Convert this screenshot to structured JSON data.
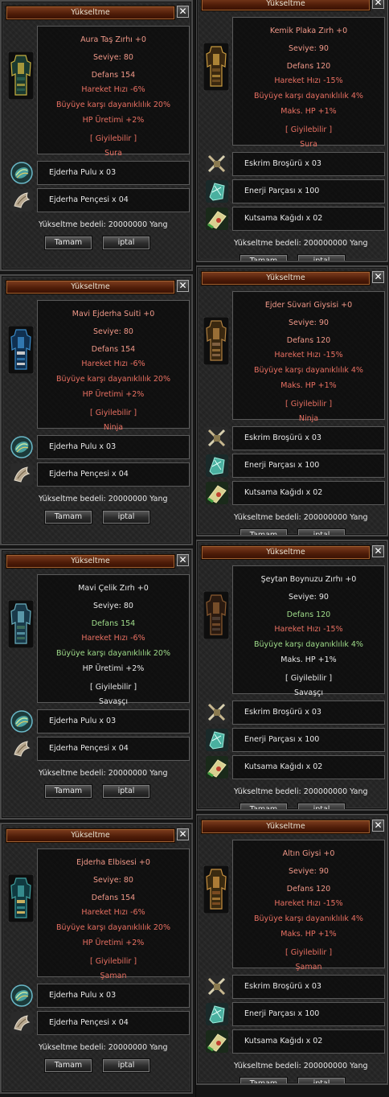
{
  "dialogs": [
    {
      "title": "Yükseltme",
      "item_icon": "armor-aura-tas-icon",
      "item_colors": [
        "#1a3a30",
        "#c8b040",
        "#2a5a4a"
      ],
      "lines": [
        {
          "text": "Aura Taş Zırhı +0",
          "color": "salmon"
        },
        {
          "text": "Seviye: 80",
          "color": "salmon"
        },
        {
          "text": "Defans 154",
          "color": "salmon"
        },
        {
          "text": "Hareket Hızı -6%",
          "color": "red"
        },
        {
          "text": "Büyüye karşı dayanıklılık 20%",
          "color": "red"
        },
        {
          "text": "HP Üretimi +2%",
          "color": "red"
        },
        {
          "text": "[ Giyilebilir ]",
          "color": "red"
        },
        {
          "text": "Sura",
          "color": "red"
        }
      ],
      "materials": [
        {
          "text": "Ejderha Pulu x 03",
          "icon": "dragon-scale-icon"
        },
        {
          "text": "Ejderha Pençesi x 04",
          "icon": "dragon-claw-icon"
        }
      ],
      "cost": "Yükseltme bedeli: 20000000 Yang",
      "ok": "Tamam",
      "cancel": "iptal"
    },
    {
      "title": "Yükseltme",
      "item_icon": "armor-kemik-plaka-icon",
      "item_colors": [
        "#3a2810",
        "#c89a40",
        "#6a4a20"
      ],
      "lines": [
        {
          "text": "Kemik Plaka Zırh +0",
          "color": "salmon"
        },
        {
          "text": "Seviye: 90",
          "color": "salmon"
        },
        {
          "text": "Defans 120",
          "color": "salmon"
        },
        {
          "text": "Hareket Hızı -15%",
          "color": "red"
        },
        {
          "text": "Büyüye karşı dayanıklılık 4%",
          "color": "red"
        },
        {
          "text": "Maks. HP +1%",
          "color": "red"
        },
        {
          "text": "[ Giyilebilir ]",
          "color": "red"
        },
        {
          "text": "Sura",
          "color": "red"
        }
      ],
      "materials": [
        {
          "text": "Eskrim Broşürü x 03",
          "icon": "fencing-brochure-icon"
        },
        {
          "text": "Enerji Parçası x 100",
          "icon": "energy-fragment-icon"
        },
        {
          "text": "Kutsama Kağıdı x 02",
          "icon": "blessing-scroll-icon"
        }
      ],
      "cost": "Yükseltme bedeli: 200000000 Yang",
      "ok": "Tamam",
      "cancel": "iptal"
    },
    {
      "title": "Yükseltme",
      "item_icon": "armor-mavi-ejderha-icon",
      "item_colors": [
        "#103050",
        "#3a8ac8",
        "#c8c8c8"
      ],
      "lines": [
        {
          "text": "Mavi Ejderha Suiti +0",
          "color": "salmon"
        },
        {
          "text": "Seviye: 80",
          "color": "salmon"
        },
        {
          "text": "Defans 154",
          "color": "salmon"
        },
        {
          "text": "Hareket Hızı -6%",
          "color": "red"
        },
        {
          "text": "Büyüye karşı dayanıklılık 20%",
          "color": "red"
        },
        {
          "text": "HP Üretimi +2%",
          "color": "red"
        },
        {
          "text": "[ Giyilebilir ]",
          "color": "red"
        },
        {
          "text": "Ninja",
          "color": "red"
        }
      ],
      "materials": [
        {
          "text": "Ejderha Pulu x 03",
          "icon": "dragon-scale-icon"
        },
        {
          "text": "Ejderha Pençesi x 04",
          "icon": "dragon-claw-icon"
        }
      ],
      "cost": "Yükseltme bedeli: 20000000 Yang",
      "ok": "Tamam",
      "cancel": "iptal"
    },
    {
      "title": "Yükseltme",
      "item_icon": "armor-ejder-suvari-icon",
      "item_colors": [
        "#3a2810",
        "#b08040",
        "#806040"
      ],
      "lines": [
        {
          "text": "Ejder Süvari Giysisi +0",
          "color": "salmon"
        },
        {
          "text": "Seviye: 90",
          "color": "salmon"
        },
        {
          "text": "Defans 120",
          "color": "salmon"
        },
        {
          "text": "Hareket Hızı -15%",
          "color": "red"
        },
        {
          "text": "Büyüye karşı dayanıklılık 4%",
          "color": "red"
        },
        {
          "text": "Maks. HP +1%",
          "color": "red"
        },
        {
          "text": "[ Giyilebilir ]",
          "color": "red"
        },
        {
          "text": "Ninja",
          "color": "red"
        }
      ],
      "materials": [
        {
          "text": "Eskrim Broşürü x 03",
          "icon": "fencing-brochure-icon"
        },
        {
          "text": "Enerji Parçası x 100",
          "icon": "energy-fragment-icon"
        },
        {
          "text": "Kutsama Kağıdı x 02",
          "icon": "blessing-scroll-icon"
        }
      ],
      "cost": "Yükseltme bedeli: 200000000 Yang",
      "ok": "Tamam",
      "cancel": "iptal"
    },
    {
      "title": "Yükseltme",
      "item_icon": "armor-mavi-celik-icon",
      "item_colors": [
        "#1a3a4a",
        "#6ab0c0",
        "#3a6a5a"
      ],
      "lines": [
        {
          "text": "Mavi Çelik Zırh +0",
          "color": "white"
        },
        {
          "text": "Seviye: 80",
          "color": "white"
        },
        {
          "text": "Defans 154",
          "color": "green"
        },
        {
          "text": "Hareket Hızı -6%",
          "color": "red"
        },
        {
          "text": "Büyüye karşı dayanıklılık 20%",
          "color": "green"
        },
        {
          "text": "HP Üretimi +2%",
          "color": "white"
        },
        {
          "text": "[ Giyilebilir ]",
          "color": "white"
        },
        {
          "text": "Savaşçı",
          "color": "white"
        }
      ],
      "materials": [
        {
          "text": "Ejderha Pulu x 03",
          "icon": "dragon-scale-icon"
        },
        {
          "text": "Ejderha Pençesi x 04",
          "icon": "dragon-claw-icon"
        }
      ],
      "cost": "Yükseltme bedeli: 20000000 Yang",
      "ok": "Tamam",
      "cancel": "iptal"
    },
    {
      "title": "Yükseltme",
      "item_icon": "armor-seytan-boynuzu-icon",
      "item_colors": [
        "#2a1a10",
        "#8a5a30",
        "#4a3a30"
      ],
      "lines": [
        {
          "text": "Şeytan Boynuzu Zırhı +0",
          "color": "white"
        },
        {
          "text": "Seviye: 90",
          "color": "white"
        },
        {
          "text": "Defans 120",
          "color": "green"
        },
        {
          "text": "Hareket Hızı -15%",
          "color": "red"
        },
        {
          "text": "Büyüye karşı dayanıklılık 4%",
          "color": "green"
        },
        {
          "text": "Maks. HP +1%",
          "color": "white"
        },
        {
          "text": "[ Giyilebilir ]",
          "color": "white"
        },
        {
          "text": "Savaşçı",
          "color": "white"
        }
      ],
      "materials": [
        {
          "text": "Eskrim Broşürü x 03",
          "icon": "fencing-brochure-icon"
        },
        {
          "text": "Enerji Parçası x 100",
          "icon": "energy-fragment-icon"
        },
        {
          "text": "Kutsama Kağıdı x 02",
          "icon": "blessing-scroll-icon"
        }
      ],
      "cost": "Yükseltme bedeli: 200000000 Yang",
      "ok": "Tamam",
      "cancel": "iptal"
    },
    {
      "title": "Yükseltme",
      "item_icon": "armor-ejderha-elbisesi-icon",
      "item_colors": [
        "#103a40",
        "#40a0a0",
        "#c8b060"
      ],
      "lines": [
        {
          "text": "Ejderha Elbisesi +0",
          "color": "salmon"
        },
        {
          "text": "Seviye: 80",
          "color": "salmon"
        },
        {
          "text": "Defans 154",
          "color": "salmon"
        },
        {
          "text": "Hareket Hızı -6%",
          "color": "red"
        },
        {
          "text": "Büyüye karşı dayanıklılık 20%",
          "color": "red"
        },
        {
          "text": "HP Üretimi +2%",
          "color": "red"
        },
        {
          "text": "[ Giyilebilir ]",
          "color": "red"
        },
        {
          "text": "Şaman",
          "color": "red"
        }
      ],
      "materials": [
        {
          "text": "Ejderha Pulu x 03",
          "icon": "dragon-scale-icon"
        },
        {
          "text": "Ejderha Pençesi x 04",
          "icon": "dragon-claw-icon"
        }
      ],
      "cost": "Yükseltme bedeli: 20000000 Yang",
      "ok": "Tamam",
      "cancel": "iptal"
    },
    {
      "title": "Yükseltme",
      "item_icon": "armor-altin-giysi-icon",
      "item_colors": [
        "#3a2a10",
        "#c89040",
        "#7a4a20"
      ],
      "lines": [
        {
          "text": "Altın Giysi +0",
          "color": "salmon"
        },
        {
          "text": "Seviye: 90",
          "color": "salmon"
        },
        {
          "text": "Defans 120",
          "color": "salmon"
        },
        {
          "text": "Hareket Hızı -15%",
          "color": "red"
        },
        {
          "text": "Büyüye karşı dayanıklılık 4%",
          "color": "red"
        },
        {
          "text": "Maks. HP +1%",
          "color": "red"
        },
        {
          "text": "[ Giyilebilir ]",
          "color": "red"
        },
        {
          "text": "Şaman",
          "color": "red"
        }
      ],
      "materials": [
        {
          "text": "Eskrim Broşürü x 03",
          "icon": "fencing-brochure-icon"
        },
        {
          "text": "Enerji Parçası x 100",
          "icon": "energy-fragment-icon"
        },
        {
          "text": "Kutsama Kağıdı x 02",
          "icon": "blessing-scroll-icon"
        }
      ],
      "cost": "Yükseltme bedeli: 200000000 Yang",
      "ok": "Tamam",
      "cancel": "iptal"
    }
  ]
}
